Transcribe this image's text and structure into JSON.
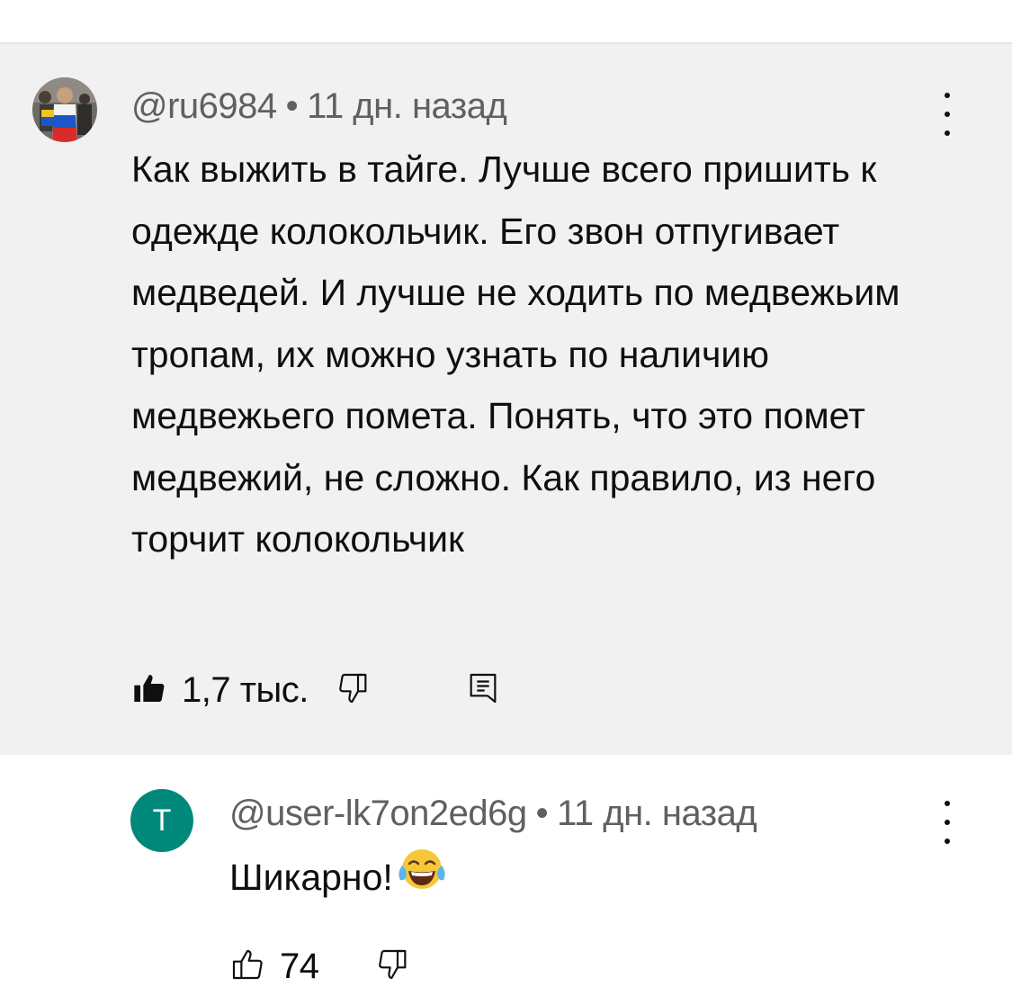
{
  "colors": {
    "highlight_bg": "#f1f1f1",
    "meta_text": "#606060",
    "avatar_t_bg": "#00897b"
  },
  "comment": {
    "author": "@ru6984",
    "separator": "•",
    "time": "11 дн. назад",
    "text": "Как выжить в тайге. Лучше всего пришить к одежде колокольчик. Его звон отпугивает медведей. И лучше не ходить по медвежьим тропам, их можно узнать по наличию медвежьего помета. Понять, что это помет медвежий, не сложно. Как правило, из него торчит колокольчик",
    "likes": "1,7 тыс.",
    "like_icon": "thumbs-up-filled-icon",
    "dislike_icon": "thumbs-down-outline-icon",
    "reply_icon": "reply-comment-icon",
    "menu_icon": "more-vertical-icon"
  },
  "reply": {
    "avatar_letter": "Т",
    "author": "@user-lk7on2ed6g",
    "separator": "•",
    "time": "11 дн. назад",
    "text": "Шикарно!",
    "emoji": "😂",
    "likes": "74",
    "like_icon": "thumbs-up-outline-icon",
    "dislike_icon": "thumbs-down-outline-icon",
    "menu_icon": "more-vertical-icon"
  }
}
